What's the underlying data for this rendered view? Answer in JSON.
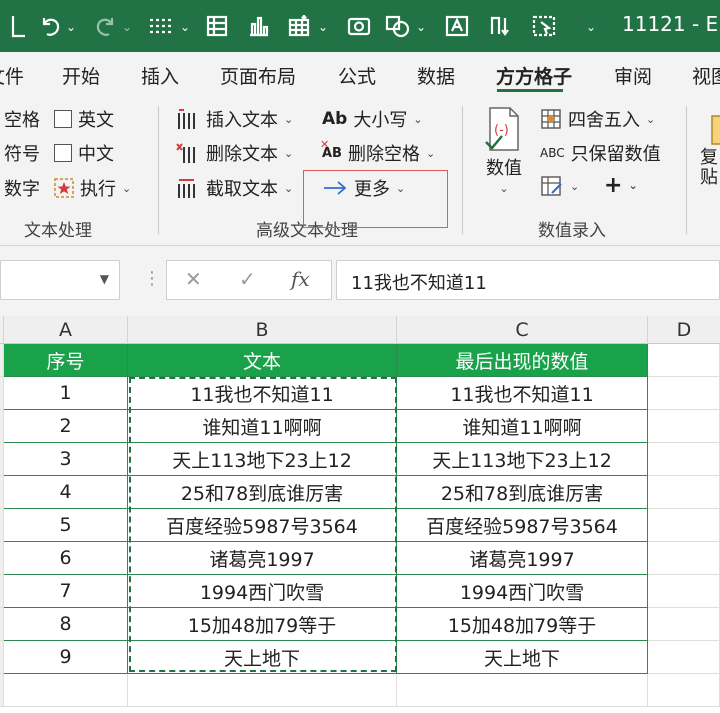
{
  "title_bar": {
    "document_title": "11121 - E>"
  },
  "tabs": [
    {
      "label": "文件",
      "active": false
    },
    {
      "label": "开始",
      "active": false
    },
    {
      "label": "插入",
      "active": false
    },
    {
      "label": "页面布局",
      "active": false
    },
    {
      "label": "公式",
      "active": false
    },
    {
      "label": "数据",
      "active": false
    },
    {
      "label": "方方格子",
      "active": true
    },
    {
      "label": "审阅",
      "active": false
    },
    {
      "label": "视图",
      "active": false
    }
  ],
  "ribbon": {
    "text_processing": {
      "items": [
        "空格",
        "英文",
        "符号",
        "中文",
        "数字",
        "执行"
      ],
      "label": "文本处理"
    },
    "advanced_text": {
      "insert_text": "插入文本",
      "delete_text": "删除文本",
      "extract_text": "截取文本",
      "case": "大小写",
      "case_icon": "Ab",
      "delete_space": "删除空格",
      "delete_space_icon": "AB",
      "more": "更多",
      "label": "高级文本处理"
    },
    "number_entry": {
      "number": "数值",
      "round": "四舍五入",
      "keep_numbers": "只保留数值",
      "keep_numbers_icon": "ABC",
      "label": "数值录入"
    },
    "copy_partial": "复 贴"
  },
  "formula_bar": {
    "cancel": "✕",
    "confirm": "✓",
    "fx": "fx",
    "content": "11我也不知道11"
  },
  "sheet": {
    "columns": [
      "A",
      "B",
      "C",
      "D"
    ],
    "headers": [
      "序号",
      "文本",
      "最后出现的数值"
    ],
    "rows": [
      [
        "1",
        "11我也不知道11",
        "11我也不知道11"
      ],
      [
        "2",
        "谁知道11啊啊",
        "谁知道11啊啊"
      ],
      [
        "3",
        "天上113地下23上12",
        "天上113地下23上12"
      ],
      [
        "4",
        "25和78到底谁厉害",
        "25和78到底谁厉害"
      ],
      [
        "5",
        "百度经验5987号3564",
        "百度经验5987号3564"
      ],
      [
        "6",
        "诸葛亮1997",
        "诸葛亮1997"
      ],
      [
        "7",
        "1994西门吹雪",
        "1994西门吹雪"
      ],
      [
        "8",
        "15加48加79等于",
        "15加48加79等于"
      ],
      [
        "9",
        "天上地下",
        "天上地下"
      ]
    ]
  },
  "colors": {
    "brand": "#217346",
    "header_fill": "#1aa24a",
    "highlight": "#e05c5c"
  }
}
